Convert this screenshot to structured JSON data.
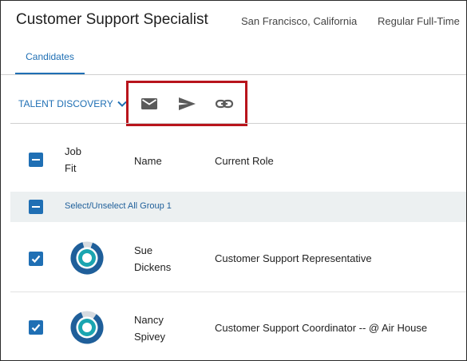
{
  "job": {
    "title": "Customer Support Specialist",
    "location": "San Francisco, California",
    "type": "Regular Full-Time"
  },
  "tabs": [
    {
      "label": "Candidates",
      "active": true
    }
  ],
  "toolbar": {
    "talent_label": "TALENT DISCOVERY",
    "actions": [
      {
        "icon": "mail-icon",
        "label": "email"
      },
      {
        "icon": "send-icon",
        "label": "send"
      },
      {
        "icon": "link-icon",
        "label": "link"
      }
    ]
  },
  "table": {
    "columns": {
      "jobfit_line1": "Job",
      "jobfit_line2": "Fit",
      "name": "Name",
      "role": "Current Role"
    },
    "group_label": "Select/Unselect All Group 1",
    "rows": [
      {
        "first": "Sue",
        "last": "Dickens",
        "role": "Customer Support Representative",
        "checked": true
      },
      {
        "first": "Nancy",
        "last": "Spivey",
        "role": "Customer Support Coordinator -- @ Air House",
        "checked": true
      }
    ]
  },
  "colors": {
    "accent": "#1f6fb4",
    "highlight_box": "#b8141c",
    "donut_outer": "#1f5f9a",
    "donut_inner": "#1aa5b0"
  }
}
